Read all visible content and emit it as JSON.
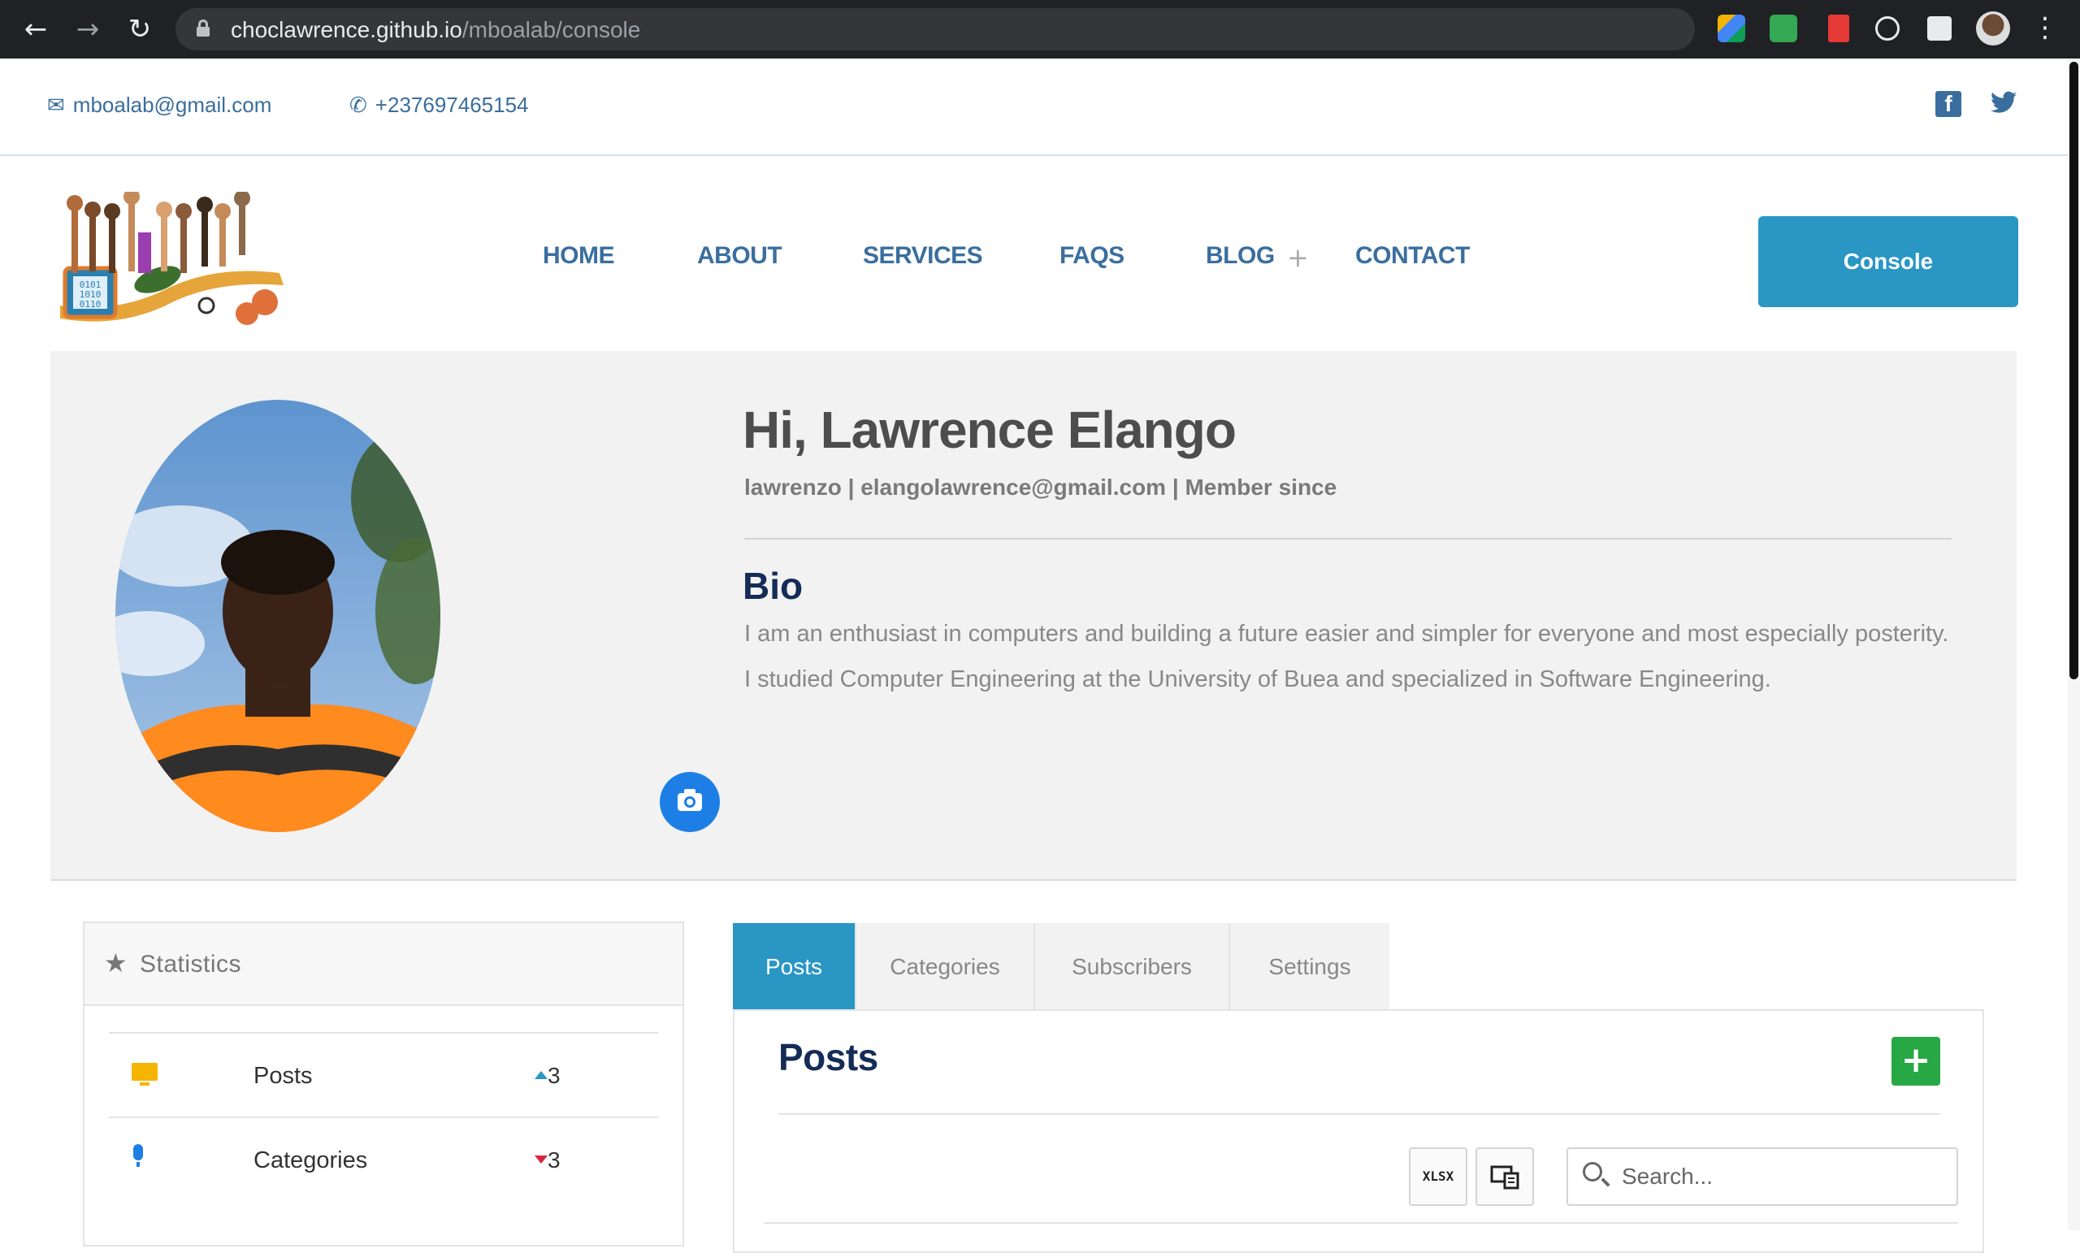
{
  "browser": {
    "url_host": "choclawrence.github.io",
    "url_path": "/mboalab/console",
    "back_icon": "←",
    "forward_icon": "→",
    "reload_icon": "↻",
    "bookmark_icon": "☆",
    "menu_icon": "⋮"
  },
  "topbar": {
    "email": "mboalab@gmail.com",
    "phone": "+237697465154",
    "email_icon": "✉",
    "phone_icon": "✆",
    "facebook_icon": "f",
    "twitter_icon": "🐦"
  },
  "nav": {
    "items": [
      {
        "label": "HOME"
      },
      {
        "label": "ABOUT"
      },
      {
        "label": "SERVICES"
      },
      {
        "label": "FAQS"
      },
      {
        "label": "BLOG"
      },
      {
        "label": "CONTACT"
      }
    ],
    "blog_expand": "+",
    "console_label": "Console"
  },
  "profile": {
    "greeting": "Hi, Lawrence Elango",
    "meta": "lawrenzo | elangolawrence@gmail.com | Member since",
    "bio_title": "Bio",
    "bio_text": "I am an enthusiast in computers and building a future easier and simpler for everyone and most especially posterity. I studied Computer Engineering at the University of Buea and specialized in Software Engineering."
  },
  "statistics": {
    "title": "Statistics",
    "rows": [
      {
        "label": "Posts",
        "count": "3",
        "trend": "up"
      },
      {
        "label": "Categories",
        "count": "3",
        "trend": "down"
      }
    ]
  },
  "tabs": [
    {
      "label": "Posts",
      "active": true
    },
    {
      "label": "Categories",
      "active": false
    },
    {
      "label": "Subscribers",
      "active": false
    },
    {
      "label": "Settings",
      "active": false
    }
  ],
  "posts": {
    "title": "Posts",
    "add_label": "+",
    "export_label": "XLSX",
    "search_placeholder": "Search..."
  },
  "colors": {
    "accent": "#2996c4",
    "nav_text": "#3a6e9e",
    "add_green": "#27a844",
    "camera_blue": "#1d7fe6"
  }
}
